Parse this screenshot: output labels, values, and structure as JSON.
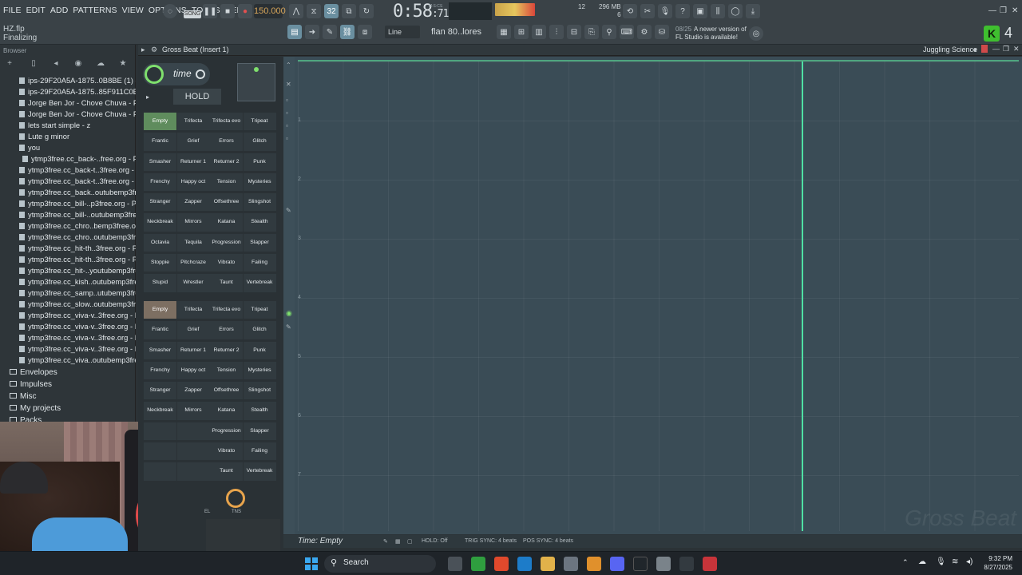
{
  "menu": [
    "FILE",
    "EDIT",
    "ADD",
    "PATTERNS",
    "VIEW",
    "OPTIONS",
    "TOOLS",
    "HELP"
  ],
  "project": {
    "file": "HZ.flp",
    "status": "Finalizing"
  },
  "transport": {
    "mode": "SONG",
    "tempo": "150.000",
    "time": "0:58",
    "time_sub": ":71",
    "time_label": "M:S:CS",
    "step": "32"
  },
  "monitor": {
    "cpu": "12",
    "memory": "296 MB",
    "poly": "6"
  },
  "toolbar2": {
    "snap": "Line",
    "pattern": "flan 80..lores"
  },
  "news": {
    "date": "08/25",
    "text": "A newer version of FL Studio is available!"
  },
  "badge": {
    "number": "4",
    "logo": "K"
  },
  "browser": {
    "title": "Browser",
    "files": [
      "ips-29F20A5A-1875..0B8BE (1) - Part_1",
      "ips-29F20A5A-1875..85F911C0B8BE (1)",
      "Jorge Ben Jor - Chove Chuva - Part_1",
      "Jorge Ben Jor - Chove Chuva - Part_2",
      "lets start simple - z",
      "Lute g minor",
      "you",
      "ytmp3free.cc_back-..free.org - Part_1",
      "ytmp3free.cc_back-t..3free.org - Part_2",
      "ytmp3free.cc_back-t..3free.org - Part_3",
      "ytmp3free.cc_back..outubemp3free.org",
      "ytmp3free.cc_bill-..p3free.org - Part_1",
      "ytmp3free.cc_bill-..outubemp3free.org",
      "ytmp3free.cc_chro..bemp3free.org (1)",
      "ytmp3free.cc_chro..outubemp3free.org",
      "ytmp3free.cc_hit-th..3free.org - Part_1",
      "ytmp3free.cc_hit-th..3free.org - Part_2",
      "ytmp3free.cc_hit-..youtubemp3free.org",
      "ytmp3free.cc_kish..outubemp3free.org",
      "ytmp3free.cc_samp..utubemp3free.org",
      "ytmp3free.cc_slow..outubemp3free.org",
      "ytmp3free.cc_viva-v..3free.org - Part_1",
      "ytmp3free.cc_viva-v..3free.org - Part_2",
      "ytmp3free.cc_viva-v..3free.org - Part_3",
      "ytmp3free.cc_viva-v..3free.org - Part_4",
      "ytmp3free.cc_viva..outubemp3free.org"
    ],
    "folders": [
      "Envelopes",
      "Impulses",
      "Misc",
      "My projects",
      "Packs"
    ]
  },
  "plugin": {
    "title": "Gross Beat (Insert 1)",
    "preset": "Juggling Science",
    "time_label": "time",
    "hold_label": "HOLD",
    "time_slots": [
      "Empty",
      "Trifecta",
      "Trifecta evo",
      "Tripeat",
      "Frantic",
      "Grief",
      "Errors",
      "Glitch",
      "Smasher",
      "Returner 1",
      "Returner 2",
      "Punk",
      "Frenchy",
      "Happy oct",
      "Tension",
      "Mysteries",
      "Stranger",
      "Zapper",
      "Offsethree",
      "Slingshot",
      "Neckbreak",
      "Mirrors",
      "Katana",
      "Stealth",
      "Octavia",
      "Tequila",
      "Progression",
      "Slapper",
      "Stoppie",
      "Pitchcraze",
      "Vibrato",
      "Failing",
      "Stupid",
      "Wrestler",
      "Taunt",
      "Vertebreak"
    ],
    "volume_slots": [
      "Empty",
      "Trifecta",
      "Trifecta evo",
      "Tripeat",
      "Frantic",
      "Grief",
      "Errors",
      "Glitch",
      "Smasher",
      "Returner 1",
      "Returner 2",
      "Punk",
      "Frenchy",
      "Happy oct",
      "Tension",
      "Mysteries",
      "Stranger",
      "Zapper",
      "Offsethree",
      "Slingshot",
      "Neckbreak",
      "Mirrors",
      "Katana",
      "Stealth",
      "",
      "",
      "Progression",
      "Slapper",
      "",
      "",
      "Vibrato",
      "Failing",
      "",
      "",
      "Taunt",
      "Vertebreak"
    ],
    "knob_tns": "TNS",
    "knob_fl": "EL",
    "watermark": "Gross Beat",
    "status": "Time: Empty",
    "hold_status": "HOLD: Off",
    "trig_sync": "TRIG SYNC: 4 beats",
    "pos_sync": "POS SYNC: 4 beats",
    "y_labels": [
      "1",
      "2",
      "3",
      "4",
      "5",
      "6",
      "7"
    ]
  },
  "taskbar": {
    "search": "Search",
    "time": "9:32 PM",
    "date": "8/27/2025"
  },
  "colors": {
    "accent_green": "#7fe06d",
    "playhead": "#4fe0a4",
    "grid_bg": "#3a4c56",
    "taskbar": "#1f2429"
  }
}
